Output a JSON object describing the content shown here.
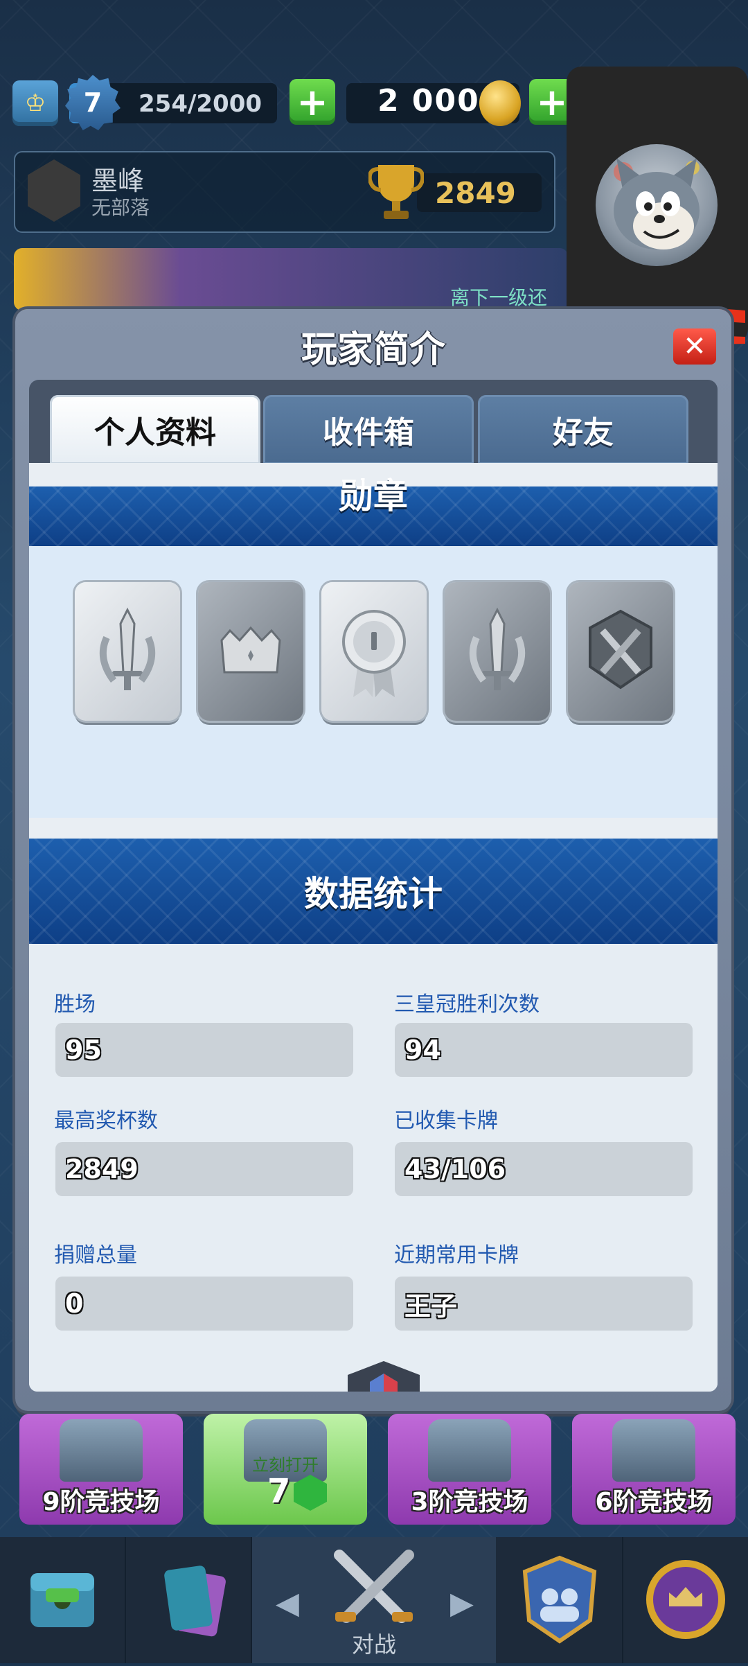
{
  "top_bar": {
    "level": "7",
    "xp": "254/2000",
    "gold": "2 000",
    "plus": "+"
  },
  "profile": {
    "player_name": "墨峰",
    "clan": "无部落",
    "trophies": "2849"
  },
  "banner": {
    "text": "离下一级还"
  },
  "modal": {
    "title": "玩家简介",
    "close": "✕",
    "tabs": [
      {
        "label": "个人资料",
        "active": true
      },
      {
        "label": "收件箱",
        "active": false
      },
      {
        "label": "好友",
        "active": false
      }
    ],
    "badges_header": "勋章",
    "stats_header": "数据统计",
    "stats": {
      "wins_label": "胜场",
      "wins": "95",
      "three_crown_label": "三皇冠胜利次数",
      "three_crown": "94",
      "best_trophies_label": "最高奖杯数",
      "best_trophies": "2849",
      "cards_found_label": "已收集卡牌",
      "cards_found": "43/106",
      "donations_label": "捐赠总量",
      "donations": "0",
      "favorite_card_label": "近期常用卡牌",
      "favorite_card": "王子"
    },
    "badges": [
      {
        "icon": "sword-laurel-badge-icon",
        "style": "light"
      },
      {
        "icon": "crown-badge-icon",
        "style": "dark"
      },
      {
        "icon": "medal-ribbon-badge-icon",
        "style": "light"
      },
      {
        "icon": "sword-laurel-badge-icon",
        "style": "dark"
      },
      {
        "icon": "crossed-swords-shield-badge-icon",
        "style": "dark"
      }
    ]
  },
  "chests": [
    {
      "label": "9阶竞技场",
      "color": "purple"
    },
    {
      "label": "立刻打开",
      "gems": "7",
      "color": "green"
    },
    {
      "label": "3阶竞技场",
      "color": "purple"
    },
    {
      "label": "6阶竞技场",
      "color": "purple"
    }
  ],
  "nav": {
    "battle_label": "对战",
    "items": [
      "shop-icon",
      "cards-icon",
      "battle-icon",
      "clan-icon",
      "events-icon"
    ]
  }
}
